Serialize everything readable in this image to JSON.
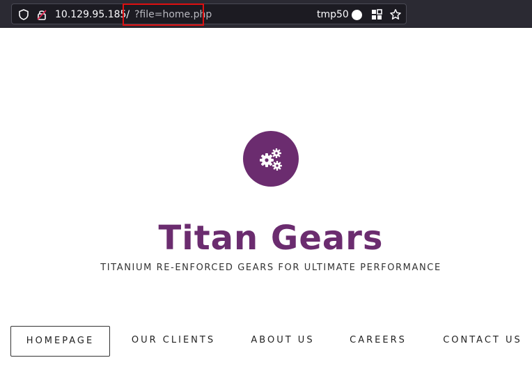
{
  "browser": {
    "url_host": "10.129.95.185/",
    "url_query": "?file=home.php",
    "container_label": "tmp50",
    "icons": [
      "shield-icon",
      "lock-icon",
      "extensions-icon",
      "star-icon"
    ]
  },
  "site": {
    "title": "Titan Gears",
    "tagline": "TITANIUM RE-ENFORCED GEARS FOR ULTIMATE PERFORMANCE",
    "logo_icon": "gears-icon"
  },
  "nav": {
    "items": [
      "HOMEPAGE",
      "OUR CLIENTS",
      "ABOUT US",
      "CAREERS",
      "CONTACT US"
    ],
    "active": "HOMEPAGE"
  },
  "colors": {
    "brand": "#6b2c6f",
    "highlight": "#e01010",
    "toolbar": "#2b2a33"
  }
}
